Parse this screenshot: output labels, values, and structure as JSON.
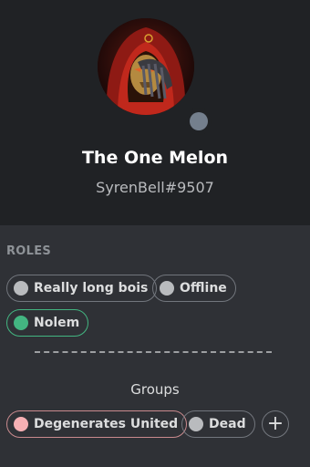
{
  "profile": {
    "display_name": "The One Melon",
    "user_tag": "SyrenBell#9507",
    "avatar_icon": "hooded-mask-avatar",
    "status_color": "#747f8d"
  },
  "roles": {
    "title": "ROLES",
    "items": [
      {
        "label": "Really long bois",
        "color": "#b9bbbe"
      },
      {
        "label": "Offline",
        "color": "#b9bbbe"
      },
      {
        "label": "Nolem",
        "color": "#43b581"
      }
    ]
  },
  "groups": {
    "title": "Groups",
    "items": [
      {
        "label": "Degenerates United",
        "color": "#f6b0b4"
      },
      {
        "label": "Dead",
        "color": "#b9bbbe"
      }
    ],
    "add_label": "+"
  }
}
